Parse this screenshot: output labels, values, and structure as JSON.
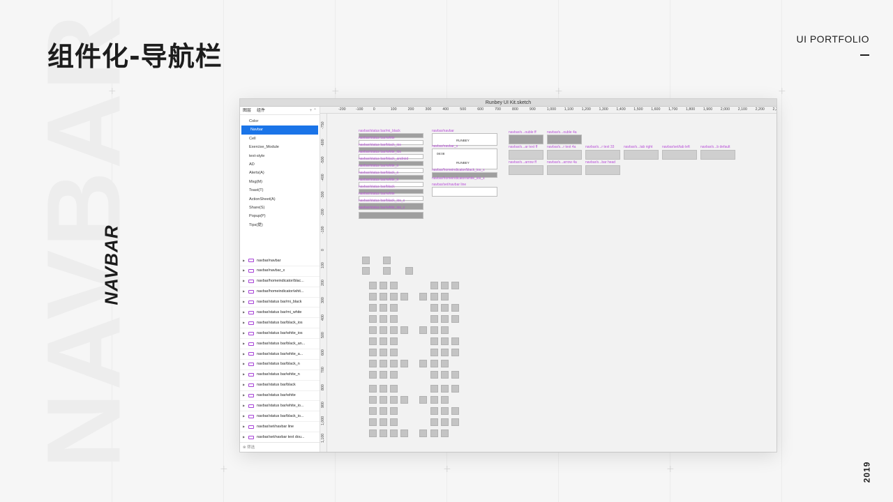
{
  "header": {
    "title": "组件化-导航栏",
    "brand": "UI PORTFOLIO",
    "year": "2019",
    "side_label": "NAVBAR",
    "background_word": "NAVBAR"
  },
  "window": {
    "title": "Runbey UI Kit.sketch",
    "panel_tabs": [
      "图层",
      "组件"
    ],
    "pages": [
      "Color",
      "Navbar",
      "Cell",
      "Exercise_Module",
      "text-style",
      "AD",
      "Alerts(A)",
      "Msg(M)",
      "Toast(T)",
      "ActionSheet(A)",
      "Share(S)",
      "Popup(P)",
      "Tips(提)"
    ],
    "selected_page": "Navbar",
    "layers": [
      "navbar/navbar",
      "navbar/navbar_x",
      "navbar/homeindicator/blac...",
      "navbar/homeindicator/whit...",
      "navbar/status bar/mi_black",
      "navbar/status bar/mi_white",
      "navbar/status bar/black_ios",
      "navbar/status bar/white_ios",
      "navbar/status bar/black_an...",
      "navbar/status bar/white_a...",
      "navbar/status bar/black_n",
      "navbar/status bar/white_n",
      "navbar/status bar/black",
      "navbar/status bar/white",
      "navbar/status bar/white_io...",
      "navbar/status bar/black_io...",
      "navbar/set/navbar line",
      "navbar/set/navbar text dou..."
    ],
    "filter_placeholder": "筛选",
    "ruler_top": [
      "-200",
      "-100",
      "0",
      "100",
      "200",
      "300",
      "400",
      "500",
      "600",
      "700",
      "800",
      "900",
      "1,000",
      "1,100",
      "1,200",
      "1,300",
      "1,400",
      "1,500",
      "1,600",
      "1,700",
      "1,800",
      "1,900",
      "2,000",
      "2,100",
      "2,200",
      "2,300"
    ],
    "ruler_left": [
      "-750",
      "-600",
      "-500",
      "-400",
      "-300",
      "-200",
      "-100",
      "0",
      "100",
      "200",
      "300",
      "400",
      "500",
      "600",
      "700",
      "800",
      "900",
      "1,000",
      "1,100"
    ],
    "artboard_labels": [
      "navbar/status bar/mi_black",
      "navbar/status bar/white",
      "navbar/status bar/black_ios",
      "navbar/status bar/white_ios",
      "navbar/status bar/black_android",
      "navbar/status bar/white_n",
      "navbar/status bar/black_n",
      "navbar/status bar/white_n",
      "navbar/status bar/black",
      "navbar/status bar/white",
      "navbar/status bar/black_ios_x",
      "navbar/status bar/white_ios_x",
      "navbar/navbar",
      "navbar/navbar_x",
      "navbar/homeindicator/black_ios_x",
      "navbar/homeindicator/white_ios_x",
      "navbar/set/navbar line",
      "navbar/s...ouble ff",
      "navbar/s...ouble 4a",
      "navbar/s...ar text ff",
      "navbar/s...r text 4a",
      "navbar/s...r text 33",
      "navbar/s...tab right",
      "navbar/set/tab left",
      "navbar/s...b default",
      "navbar/s...arrow ff",
      "navbar/s...arrow 4a",
      "navbar/s...bar head"
    ],
    "mock_text": {
      "runbey": "RUNBEY",
      "time": "08:08",
      "practice": "顺序练习"
    }
  }
}
